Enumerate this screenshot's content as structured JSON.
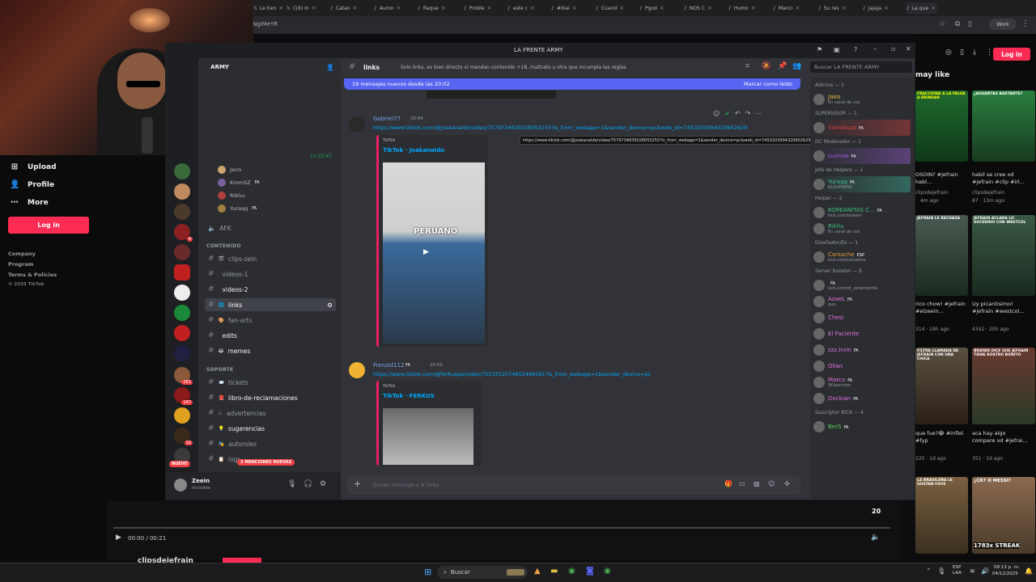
{
  "browser": {
    "tabs": [
      {
        "label": "Le tien",
        "icon": "x-icon"
      },
      {
        "label": "(19) In",
        "icon": "x-icon"
      },
      {
        "label": "Catan",
        "icon": "tiktok-icon"
      },
      {
        "label": "Auron",
        "icon": "tiktok-icon"
      },
      {
        "label": "Raque",
        "icon": "tiktok-icon"
      },
      {
        "label": "Proble",
        "icon": "tiktok-icon"
      },
      {
        "label": "este c",
        "icon": "tiktok-icon"
      },
      {
        "label": "#ibai",
        "icon": "tiktok-icon"
      },
      {
        "label": "Cuand",
        "icon": "tiktok-icon"
      },
      {
        "label": "Pgod",
        "icon": "tiktok-icon"
      },
      {
        "label": "NOS C",
        "icon": "tiktok-icon"
      },
      {
        "label": "Humo",
        "icon": "tiktok-icon"
      },
      {
        "label": "Manci",
        "icon": "tiktok-icon"
      },
      {
        "label": "Su res",
        "icon": "tiktok-icon"
      },
      {
        "label": "Jajaja",
        "icon": "tiktok-icon"
      },
      {
        "label": "La que",
        "icon": "tiktok-icon"
      }
    ],
    "address_fragment": "NgiMeYR",
    "profile_label": "Work"
  },
  "tiktok": {
    "nav": [
      {
        "icon": "plus-square-icon",
        "label": "Upload"
      },
      {
        "icon": "person-icon",
        "label": "Profile"
      },
      {
        "icon": "more-dots-icon",
        "label": "More"
      }
    ],
    "login_label": "Log in",
    "footer": [
      "Company",
      "Program",
      "Terms & Policies",
      "© 2025 TikTok"
    ],
    "right_login": "Log in",
    "you_may_like": "may like",
    "videos": [
      {
        "caption": "OSOIN? #jefrain habl...",
        "user": "clipsdejefrain",
        "meta": "4m ago",
        "color": "#1c5c2a"
      },
      {
        "caption": "habil se cree xd #jefrain #clip #irl...",
        "user": "clipsdejefrain",
        "meta": "87 · 13m ago",
        "color": "#2a6a32"
      },
      {
        "caption": "rico chow! #jefrain #elzeein...",
        "user": "Jefrain",
        "meta": "314 · 19h ago",
        "color": "#344a3a"
      },
      {
        "caption": "Uy picantisimo! #jefrain #westcol...",
        "user": "Jefrain",
        "meta": "4342 · 20h ago",
        "color": "#2e4a36"
      },
      {
        "caption": "que fue?😂 #infiel #fyp",
        "user": "Jefrain",
        "meta": "225 · 1d ago",
        "color": "#3a3a2a"
      },
      {
        "caption": "aca hay algo compare xd #jefrai...",
        "user": "clipsdejefrain",
        "meta": "351 · 1d ago",
        "color": "#5a2a2a"
      }
    ],
    "video_overlays": [
      "FRACCIONA A LA FALSA A BRINDAR",
      "¿AGUANTAS BASTANTE?",
      "JEFRAIN LE RECHAZA",
      "JEFRAIN ACLARA LO SUCEDIDO CON WESTCOL",
      "FILTRA LLAMADA DE JEFRAIN CON UNA CHICA",
      "BRAYAN DICE QUE JEFRAIN TIENE ROSTRO BONITO",
      "LA BRASILEÑA LE GUSTAN FEOS",
      "¿CR7 O MESSI?"
    ],
    "streak": "1783x STREAK",
    "player_time": "00:00 / 00:21",
    "channel_name": "clipsdejefrain",
    "comment_count": "20"
  },
  "discord": {
    "window_title": "LA FRENTE ARMY",
    "server_name": "ARMY",
    "channel_header": "links",
    "channel_topic": "Solo links, es bien directo si mandan contenido +18, maltrato u otra que incumpla las reglas",
    "search_placeholder": "Buscar LA FRENTE ARMY",
    "new_messages_banner": "19 mensajes nuevos desde las 20:02",
    "mark_read": "Marcar como leído",
    "voice_time": "11:03:47",
    "voice_users": [
      {
        "name": "Jairo",
        "color": "#c9a66b"
      },
      {
        "name": "KromSZ",
        "badge": "FA",
        "color": "#7a5fa0"
      },
      {
        "name": "Rikhu",
        "color": "#b04040"
      },
      {
        "name": "Yuraqq",
        "badge": "FA",
        "color": "#a08040"
      }
    ],
    "afk": "AFK",
    "cat_contenido": "CONTENIDO",
    "cat_soporte": "SOPORTE",
    "channels_content": [
      {
        "name": "clips-zein",
        "emoji": "🎬",
        "bright": false
      },
      {
        "name": "videos-1",
        "emoji": "",
        "bright": false
      },
      {
        "name": "videos-2",
        "emoji": "",
        "bright": true
      },
      {
        "name": "links",
        "emoji": "🌐",
        "bright": true,
        "selected": true
      },
      {
        "name": "fan-arts",
        "emoji": "🎨",
        "bright": false
      },
      {
        "name": "edits",
        "emoji": "",
        "bright": true
      },
      {
        "name": "memes",
        "emoji": "😂",
        "bright": true
      }
    ],
    "channels_support": [
      {
        "name": "tickets",
        "emoji": "📨",
        "bright": false
      },
      {
        "name": "libro-de-reclamaciones",
        "emoji": "📕",
        "bright": true
      },
      {
        "name": "advertencias",
        "emoji": "⚠",
        "bright": false
      },
      {
        "name": "sugerencias",
        "emoji": "💡",
        "bright": true
      },
      {
        "name": "autoroles",
        "emoji": "🎭",
        "bright": false
      },
      {
        "name": "logs",
        "emoji": "📋",
        "bright": false
      }
    ],
    "mentions_pill": "3 MENCIONES NUEVAS",
    "new_pill": "NUEVO",
    "guild_badges": [
      "4",
      "147",
      "12",
      "3",
      "261",
      "12"
    ],
    "user": {
      "name": "Zeein",
      "status": "Invisible"
    },
    "messages": [
      {
        "author": "Gabriel77",
        "time": "20:04",
        "link": "https://www.tiktok.com/@joakanaldo/video/7579734835028053255?is_from_webapp=1&sender_device=pc&web_id=7453203994320602629",
        "provider": "TikTok",
        "title": "TikTok · Joakanaldo",
        "overlay": "PERUANO"
      },
      {
        "author": "Frenzid112",
        "badge": "FA",
        "time": "20:05",
        "link": "https://www.tiktok.com/@ferkuspe/video/7553312574855466261?is_from_webapp=1&sender_device=pc",
        "provider": "TikTok",
        "title": "TikTok · FERKUS"
      }
    ],
    "tooltip": "https://www.tiktok.com/@joakanaldo/video/7579734835028053255?is_from_webapp=1&sender_device=pc&web_id=7453203994320602629",
    "input_placeholder": "Enviar mensaje a # links",
    "member_roles": [
      {
        "label": "Admins — 1",
        "members": [
          {
            "name": "Jairo",
            "sub": "En canal de voz",
            "color": "#f0c040"
          }
        ]
      },
      {
        "label": "SUPERVISOR — 1",
        "members": [
          {
            "name": "Sainsbuzz",
            "badge": "FA",
            "color": "#e04040"
          }
        ]
      },
      {
        "label": "DC Moderador — 1",
        "members": [
          {
            "name": "Lunnao",
            "badge": "FA",
            "color": "#a060e0"
          }
        ]
      },
      {
        "label": "Jefe de Helpers — 1",
        "members": [
          {
            "name": "Yuraqq",
            "badge": "FA",
            "sub": "KLOUFRENS",
            "color": "#40c0a0"
          }
        ]
      },
      {
        "label": "Helper — 2",
        "members": [
          {
            "name": "KOREANITAS C...",
            "badge": "FA",
            "sub": "kick.com/elzeein",
            "color": "#40c080"
          },
          {
            "name": "Rikhu",
            "sub": "En canal de voz",
            "color": "#40c080"
          }
        ]
      },
      {
        "label": "Diseñador/Es — 1",
        "members": [
          {
            "name": "Carsache",
            "badge": "ESP",
            "sub": "kick.com/carsache",
            "color": "#e0a040"
          }
        ]
      },
      {
        "label": "Server booster — 8",
        "members": [
          {
            "name": "",
            "badge": "FA",
            "sub": "kick.com/dr_zaramtartle",
            "color": "#e070e0"
          },
          {
            "name": "AzaeL",
            "badge": "FA",
            "sub": "que",
            "color": "#e070e0"
          },
          {
            "name": "Chesl",
            "color": "#e070e0"
          },
          {
            "name": "El Paciente",
            "color": "#e070e0"
          },
          {
            "name": "zzz.Irvin",
            "badge": "FA",
            "color": "#e070e0"
          },
          {
            "name": "Ollan",
            "color": "#e070e0"
          },
          {
            "name": "Marco",
            "badge": "FA",
            "sub": "SKlauncher",
            "color": "#e070e0"
          },
          {
            "name": "Dockian",
            "badge": "FA",
            "color": "#e070e0"
          }
        ]
      },
      {
        "label": "Suscriptor KICK — 4",
        "members": [
          {
            "name": "BerS",
            "badge": "FA",
            "color": "#60d060"
          }
        ]
      }
    ]
  },
  "taskbar": {
    "search": "Buscar",
    "lang": "ESP\nLAA",
    "time": "08:13 p. m.",
    "date": "04/12/2025"
  }
}
